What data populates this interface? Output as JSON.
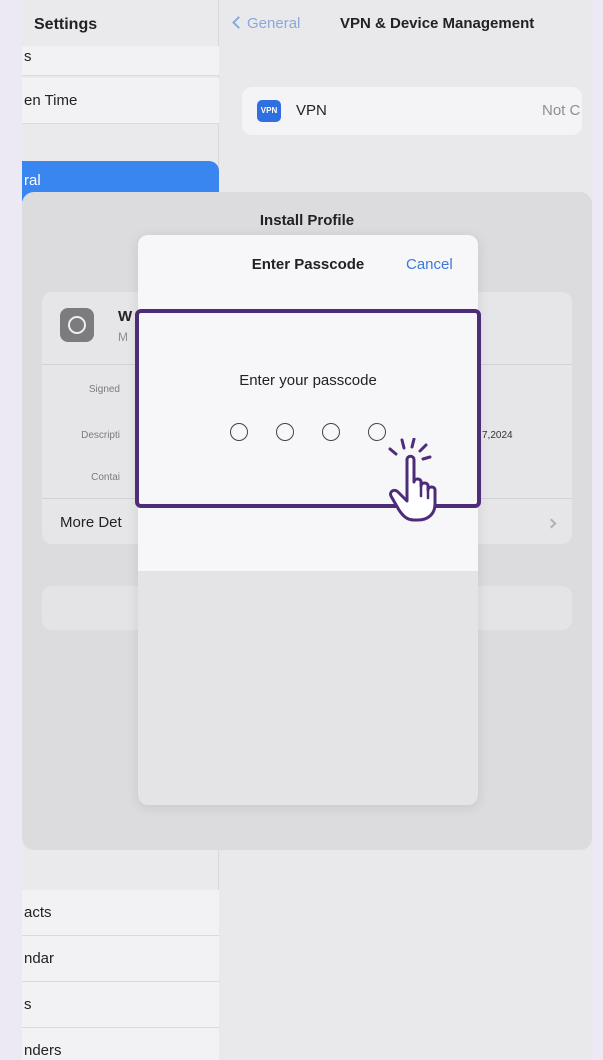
{
  "sidebar": {
    "title": "Settings",
    "items_top": [
      "s",
      "en Time"
    ],
    "selected": "ral",
    "items_bottom": [
      "acts",
      "ndar",
      "s",
      "nders"
    ]
  },
  "nav": {
    "back_label": "General",
    "title": "VPN & Device Management"
  },
  "vpn_row": {
    "badge": "VPN",
    "label": "VPN",
    "status": "Not C"
  },
  "install_profile": {
    "title": "Install Profile",
    "profile_name": "W",
    "profile_sub": "M",
    "signed_label": "Signed",
    "description_label": "Descripti",
    "contains_label": "Contai",
    "date_value": "7,2024",
    "more_details": "More Det"
  },
  "passcode_modal": {
    "title": "Enter Passcode",
    "cancel": "Cancel",
    "prompt": "Enter your passcode",
    "digits_total": 4,
    "digits_entered": 0
  },
  "colors": {
    "highlight": "#4d2c78",
    "accent": "#3a7ad8",
    "selected_bg": "#3a86f0"
  }
}
